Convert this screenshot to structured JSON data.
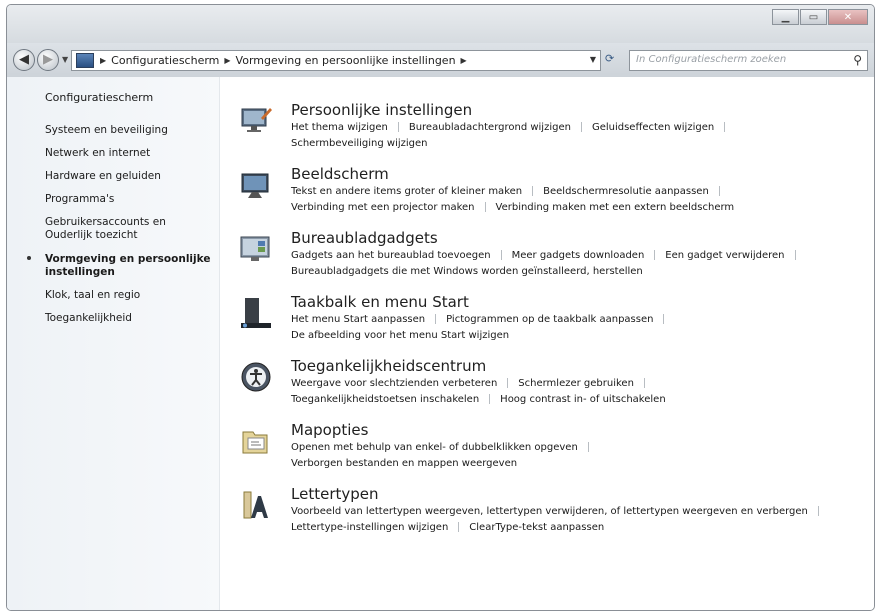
{
  "address": {
    "crumbs": [
      "Configuratiescherm",
      "Vormgeving en persoonlijke instellingen"
    ]
  },
  "search": {
    "placeholder": "In Configuratiescherm zoeken"
  },
  "sidebar": {
    "title": "Configuratiescherm",
    "items": [
      {
        "label": "Systeem en beveiliging",
        "active": false
      },
      {
        "label": "Netwerk en internet",
        "active": false
      },
      {
        "label": "Hardware en geluiden",
        "active": false
      },
      {
        "label": "Programma's",
        "active": false
      },
      {
        "label": "Gebruikersaccounts en Ouderlijk toezicht",
        "active": false
      },
      {
        "label": "Vormgeving en persoonlijke instellingen",
        "active": true
      },
      {
        "label": "Klok, taal en regio",
        "active": false
      },
      {
        "label": "Toegankelijkheid",
        "active": false
      }
    ]
  },
  "categories": [
    {
      "title": "Persoonlijke instellingen",
      "icon": "personalization-icon",
      "rows": [
        [
          "Het thema wijzigen",
          "Bureaubladachtergrond wijzigen",
          "Geluidseffecten wijzigen"
        ],
        [
          "Schermbeveiliging wijzigen"
        ]
      ]
    },
    {
      "title": "Beeldscherm",
      "icon": "display-icon",
      "rows": [
        [
          "Tekst en andere items groter of kleiner maken",
          "Beeldschermresolutie aanpassen"
        ],
        [
          "Verbinding met een projector maken",
          "Verbinding maken met een extern beeldscherm"
        ]
      ]
    },
    {
      "title": "Bureaubladgadgets",
      "icon": "gadgets-icon",
      "rows": [
        [
          "Gadgets aan het bureaublad toevoegen",
          "Meer gadgets downloaden",
          "Een gadget verwijderen"
        ],
        [
          "Bureaubladgadgets die met Windows worden geïnstalleerd, herstellen"
        ]
      ]
    },
    {
      "title": "Taakbalk en menu Start",
      "icon": "taskbar-icon",
      "rows": [
        [
          "Het menu Start aanpassen",
          "Pictogrammen op de taakbalk aanpassen"
        ],
        [
          "De afbeelding voor het menu Start wijzigen"
        ]
      ]
    },
    {
      "title": "Toegankelijkheidscentrum",
      "icon": "accessibility-icon",
      "rows": [
        [
          "Weergave voor slechtzienden verbeteren",
          "Schermlezer gebruiken"
        ],
        [
          "Toegankelijkheidstoetsen inschakelen",
          "Hoog contrast in- of uitschakelen"
        ]
      ]
    },
    {
      "title": "Mapopties",
      "icon": "folder-options-icon",
      "rows": [
        [
          "Openen met behulp van enkel- of dubbelklikken opgeven"
        ],
        [
          "Verborgen bestanden en mappen weergeven"
        ]
      ]
    },
    {
      "title": "Lettertypen",
      "icon": "fonts-icon",
      "rows": [
        [
          "Voorbeeld van lettertypen weergeven, lettertypen verwijderen, of lettertypen weergeven en verbergen"
        ],
        [
          "Lettertype-instellingen wijzigen",
          "ClearType-tekst aanpassen"
        ]
      ]
    }
  ]
}
